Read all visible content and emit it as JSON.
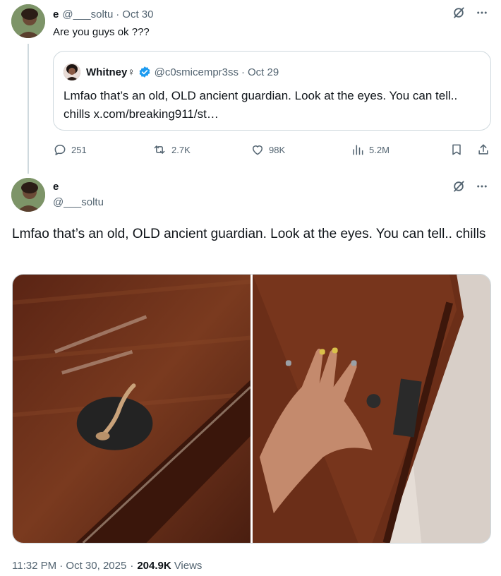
{
  "tweet1": {
    "name": "e",
    "handle": "@___soltu",
    "separator": "·",
    "date": "Oct 30",
    "text": "Are you guys ok ???",
    "quote": {
      "name": "Whitney♀",
      "verified_icon": "verified-badge-icon",
      "handle": "@c0smicempr3ss",
      "separator": "·",
      "date": "Oct 29",
      "text": "Lmfao that’s an old, OLD ancient guardian. Look at the eyes. You can tell.. chills x.com/breaking911/st…"
    },
    "actions": {
      "replies": "251",
      "reposts": "2.7K",
      "likes": "98K",
      "views": "5.2M"
    }
  },
  "tweet2": {
    "name": "e",
    "handle": "@___soltu",
    "text": "Lmfao that’s an old, OLD ancient guardian. Look at the eyes. You can tell.. chills",
    "timestamp": "11:32 PM · Oct 30, 2025",
    "dot": "·",
    "views_count": "204.9K",
    "views_label": "Views"
  },
  "colors": {
    "text": "#0f1419",
    "muted": "#536471",
    "border": "#cfd9de",
    "verified": "#1d9bf0"
  }
}
